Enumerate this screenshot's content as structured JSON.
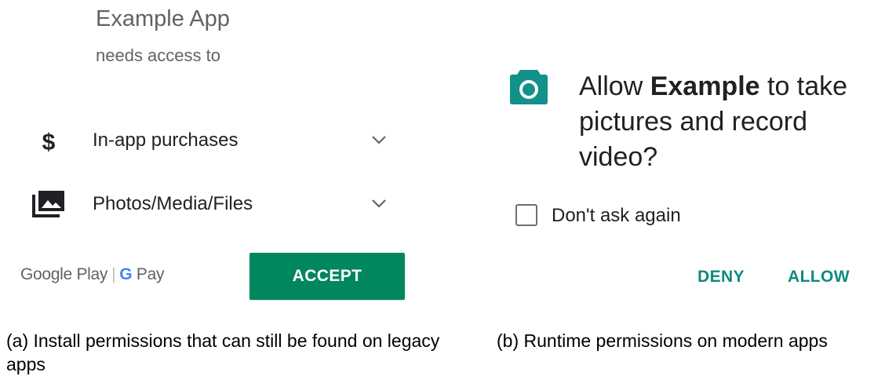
{
  "panel_a": {
    "app_name": "Example App",
    "subtitle": "needs access to",
    "permissions": [
      {
        "icon": "dollar-icon",
        "label": "In-app purchases",
        "expand_icon": "chevron-down-icon"
      },
      {
        "icon": "photos-icon",
        "label": "Photos/Media/Files",
        "expand_icon": "chevron-down-icon"
      }
    ],
    "store_logo": {
      "play": "Google Play",
      "pay_g": "G",
      "pay": "Pay"
    },
    "accept_label": "ACCEPT",
    "colors": {
      "accept": "#01875f",
      "text_muted": "#5f6368"
    }
  },
  "panel_b": {
    "icon": "camera-icon",
    "prompt_prefix": "Allow ",
    "prompt_app": "Example",
    "prompt_suffix": " to take pictures and record video?",
    "checkbox_label": "Don't ask again",
    "checkbox_checked": false,
    "deny_label": "DENY",
    "allow_label": "ALLOW",
    "colors": {
      "icon": "#12908a",
      "action": "#0f8a7e"
    }
  },
  "captions": {
    "a": "(a)  Install permissions that can still be found on legacy apps",
    "b": "(b)  Runtime permissions on modern apps"
  }
}
